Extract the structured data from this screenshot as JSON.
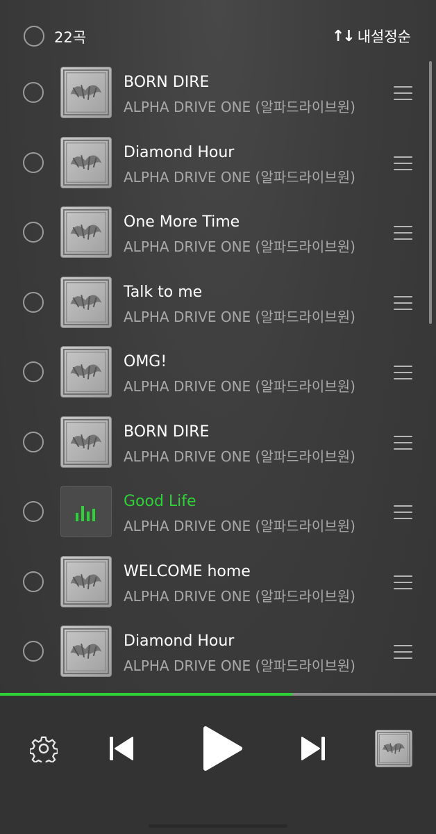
{
  "header": {
    "count_label": "22곡",
    "sort_label": "내설정순",
    "sort_icon": "sort-arrows-icon"
  },
  "tracks": [
    {
      "title": "BORN DIRE",
      "artist": "ALPHA DRIVE ONE (알파드라이브원)",
      "playing": false
    },
    {
      "title": "Diamond Hour",
      "artist": "ALPHA DRIVE ONE (알파드라이브원)",
      "playing": false
    },
    {
      "title": "One More Time",
      "artist": "ALPHA DRIVE ONE (알파드라이브원)",
      "playing": false
    },
    {
      "title": "Talk to me",
      "artist": "ALPHA DRIVE ONE (알파드라이브원)",
      "playing": false
    },
    {
      "title": "OMG!",
      "artist": "ALPHA DRIVE ONE (알파드라이브원)",
      "playing": false
    },
    {
      "title": "BORN DIRE",
      "artist": "ALPHA DRIVE ONE (알파드라이브원)",
      "playing": false
    },
    {
      "title": "Good Life",
      "artist": "ALPHA DRIVE ONE (알파드라이브원)",
      "playing": true
    },
    {
      "title": "WELCOME home",
      "artist": "ALPHA DRIVE ONE (알파드라이브원)",
      "playing": false
    },
    {
      "title": "Diamond Hour",
      "artist": "ALPHA DRIVE ONE (알파드라이브원)",
      "playing": false
    }
  ],
  "player": {
    "progress_fraction": 0.67,
    "icons": [
      "gear-icon",
      "previous-track-icon",
      "play-icon",
      "next-track-icon"
    ]
  },
  "colors": {
    "accent": "#2ed138",
    "background": "#3b3b3b",
    "player_bar": "#333333",
    "secondary_text": "#a8a8a8"
  }
}
